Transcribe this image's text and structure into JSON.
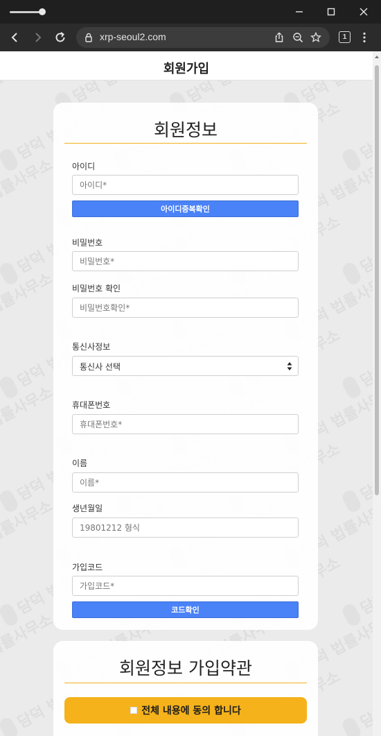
{
  "browser": {
    "url": "xrp-seoul2.com",
    "tab_count": "1",
    "icons": [
      "back-icon",
      "forward-icon",
      "reload-icon",
      "site-info-icon",
      "share-icon",
      "zoom-out-icon",
      "bookmark-icon",
      "tab-count-icon",
      "menu-icon",
      "minimize-icon",
      "maximize-icon",
      "close-icon"
    ]
  },
  "page": {
    "header_title": "회원가입",
    "watermark_text": "담덕 법률사무소"
  },
  "member_form": {
    "title": "회원정보",
    "id_label": "아이디",
    "id_placeholder": "아이디*",
    "id_check_button": "아이디중복확인",
    "password_label": "비밀번호",
    "password_placeholder": "비밀번호*",
    "password_confirm_label": "비밀번호 확인",
    "password_confirm_placeholder": "비밀번호확인*",
    "carrier_label": "통신사정보",
    "carrier_selected": "통신사 선택",
    "phone_label": "휴대폰번호",
    "phone_placeholder": "휴대폰번호*",
    "name_label": "이름",
    "name_placeholder": "이름*",
    "birth_label": "생년월일",
    "birth_placeholder": "19801212 형식",
    "signup_code_label": "가입코드",
    "signup_code_placeholder": "가입코드*",
    "code_check_button": "코드확인"
  },
  "terms": {
    "title": "회원정보 가입약관",
    "agree_all_label": "전체 내용에 동의 합니다"
  },
  "colors": {
    "accent_yellow": "#f5b21b",
    "button_blue": "#4a82f7"
  }
}
